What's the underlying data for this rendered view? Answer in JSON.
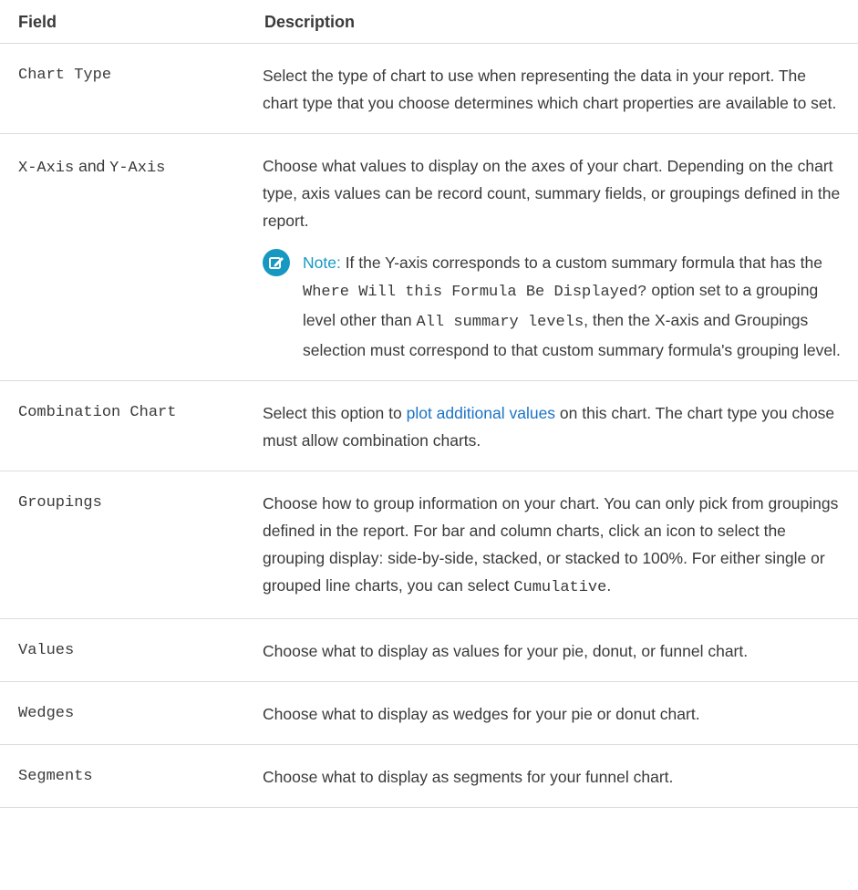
{
  "header": {
    "field": "Field",
    "description": "Description"
  },
  "rows": [
    {
      "field": "Chart Type",
      "desc": "Select the type of chart to use when representing the data in your report. The chart type that you choose determines which chart properties are available to set."
    },
    {
      "field_a": "X-Axis",
      "field_and": " and ",
      "field_b": "Y-Axis",
      "desc": "Choose what values to display on the axes of your chart. Depending on the chart type, axis values can be record count, summary fields, or groupings defined in the report.",
      "note": {
        "label": "Note:",
        "t1": " If the Y-axis corresponds to a custom summary formula that has the ",
        "code1": "Where Will this Formula Be Displayed?",
        "t2": " option set to a grouping level other than ",
        "code2": "All summary levels",
        "t3": ", then the X-axis and Groupings selection must correspond to that custom summary formula's grouping level."
      }
    },
    {
      "field": "Combination Chart",
      "desc_pre": "Select this option to ",
      "link": "plot additional values",
      "desc_post": " on this chart. The chart type you chose must allow combination charts."
    },
    {
      "field": "Groupings",
      "desc": "Choose how to group information on your chart. You can only pick from groupings defined in the report. For bar and column charts, click an icon to select the grouping display: side-by-side, stacked, or stacked to 100%. For either single or grouped line charts, you can select ",
      "code": "Cumulative",
      "desc_end": "."
    },
    {
      "field": "Values",
      "desc": "Choose what to display as values for your pie, donut, or funnel chart."
    },
    {
      "field": "Wedges",
      "desc": "Choose what to display as wedges for your pie or donut chart."
    },
    {
      "field": "Segments",
      "desc": "Choose what to display as segments for your funnel chart."
    }
  ],
  "colors": {
    "link": "#1a73c8",
    "note_icon": "#1798c1",
    "border": "#dcdcdc"
  },
  "icons": {
    "note": "edit-note-icon"
  }
}
